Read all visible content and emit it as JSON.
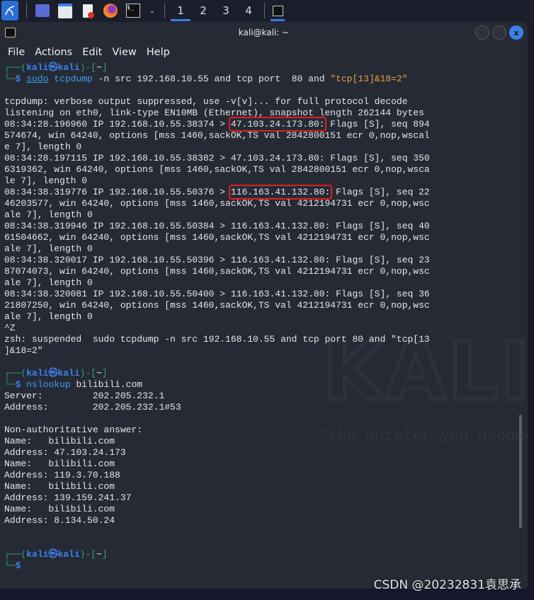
{
  "taskbar": {
    "workspaces": [
      "1",
      "2",
      "3",
      "4"
    ],
    "active_workspace": "1"
  },
  "window": {
    "title": "kali@kali: ~",
    "close_label": "x"
  },
  "menu": [
    "File",
    "Actions",
    "Edit",
    "View",
    "Help"
  ],
  "prompt": {
    "open": "┌──(",
    "user": "kali",
    "at": "㉿",
    "host": "kali",
    "close": ")-[",
    "dir": "~",
    "end": "]",
    "corner": "└─",
    "dollar": "$"
  },
  "commands": {
    "c1": {
      "bin": "sudo",
      "rest1": " tcpdump",
      "rest2": " -n src 192.168.10.55 and tcp port  80 and ",
      "str": "\"tcp[13]&18=2\""
    },
    "c2": {
      "bin": "nslookup",
      "rest": " bilibili.com"
    }
  },
  "output1": [
    {
      "t": "tcpdump: verbose output suppressed, use -v[v]... for full protocol decode"
    },
    {
      "t": "listening on eth0, link-type EN10MB (Ethernet), snapshot length 262144 bytes"
    },
    {
      "t": "08:34:28.196960 IP 192.168.10.55.38374 > ",
      "hl": "47.103.24.173.80:",
      "post": " Flags [S], seq 894"
    },
    {
      "t": "574674, win 64240, options [mss 1460,sackOK,TS val 2842800151 ecr 0,nop,wscal"
    },
    {
      "t": "e 7], length 0"
    },
    {
      "t": "08:34:28.197115 IP 192.168.10.55.38382 > 47.103.24.173.80: Flags [S], seq 350"
    },
    {
      "t": "6319362, win 64240, options [mss 1460,sackOK,TS val 2842800151 ecr 0,nop,wsca"
    },
    {
      "t": "le 7], length 0"
    },
    {
      "t": "08:34:38.319776 IP 192.168.10.55.50376 > ",
      "hl": "116.163.41.132.80:",
      "post": " Flags [S], seq 22"
    },
    {
      "t": "46203577, win 64240, options [mss 1460,sackOK,TS val 4212194731 ecr 0,nop,wsc"
    },
    {
      "t": "ale 7], length 0"
    },
    {
      "t": "08:34:38.319946 IP 192.168.10.55.50384 > 116.163.41.132.80: Flags [S], seq 40"
    },
    {
      "t": "61504662, win 64240, options [mss 1460,sackOK,TS val 4212194731 ecr 0,nop,wsc"
    },
    {
      "t": "ale 7], length 0"
    },
    {
      "t": "08:34:38.320017 IP 192.168.10.55.50396 > 116.163.41.132.80: Flags [S], seq 23"
    },
    {
      "t": "87074073, win 64240, options [mss 1460,sackOK,TS val 4212194731 ecr 0,nop,wsc"
    },
    {
      "t": "ale 7], length 0"
    },
    {
      "t": "08:34:38.320081 IP 192.168.10.55.50400 > 116.163.41.132.80: Flags [S], seq 36"
    },
    {
      "t": "21807250, win 64240, options [mss 1460,sackOK,TS val 4212194731 ecr 0,nop,wsc"
    },
    {
      "t": "ale 7], length 0"
    },
    {
      "t": "^Z"
    },
    {
      "t": "zsh: suspended  sudo tcpdump -n src 192.168.10.55 and tcp port 80 and \"tcp[13"
    },
    {
      "t": "]&18=2\""
    },
    {
      "t": ""
    }
  ],
  "output2": [
    {
      "t": "Server:\t\t202.205.232.1"
    },
    {
      "t": "Address:\t202.205.232.1#53"
    },
    {
      "t": ""
    },
    {
      "t": "Non-authoritative answer:"
    },
    {
      "t": "Name:\tbilibili.com"
    },
    {
      "t": "Address: 47.103.24.173"
    },
    {
      "t": "Name:\tbilibili.com"
    },
    {
      "t": "Address: 119.3.70.188"
    },
    {
      "t": "Name:\tbilibili.com"
    },
    {
      "t": "Address: 139.159.241.37"
    },
    {
      "t": "Name:\tbilibili.com"
    },
    {
      "t": "Address: 8.134.50.24"
    },
    {
      "t": ""
    },
    {
      "t": ""
    }
  ],
  "watermark": {
    "logo": "KALI",
    "motto": "\"the quieter you become"
  },
  "credit": "CSDN @20232831袁思承",
  "colors": {
    "prompt_frame": "#2fa37a",
    "prompt_user": "#3b82e8",
    "highlight_box": "#e0201c",
    "string": "#e8a33b"
  }
}
